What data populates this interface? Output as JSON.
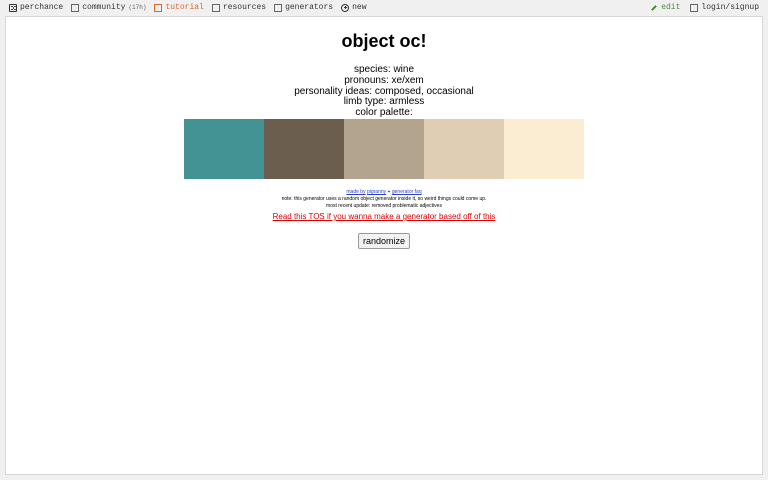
{
  "nav": {
    "left": [
      {
        "label": "perchance",
        "icon": "dice-icon"
      },
      {
        "label": "community",
        "count": "(17h)",
        "icon": "community-icon"
      },
      {
        "label": "tutorial",
        "icon": "book-icon"
      },
      {
        "label": "resources",
        "icon": "box-icon"
      },
      {
        "label": "generators",
        "icon": "grid-icon"
      },
      {
        "label": "new",
        "icon": "plus-circle-icon"
      }
    ],
    "right": [
      {
        "label": "edit",
        "icon": "pencil-icon"
      },
      {
        "label": "login/signup",
        "icon": "user-icon"
      }
    ],
    "accent_tutorial": "#d8682a",
    "accent_edit": "#4a8f3a"
  },
  "page": {
    "title": "object oc!",
    "lines": [
      "species: wine",
      "pronouns: xe/xem",
      "personality ideas: composed, occasional",
      "limb type: armless",
      "color palette:"
    ],
    "palette": [
      "#439395",
      "#6b5e4e",
      "#b2a48f",
      "#dfceb3",
      "#fbedd2"
    ],
    "credits": {
      "made_by_prefix": "made by",
      "made_by_link": "pigranny",
      "separator": "+",
      "faq_link": "generator faq",
      "note": "note: this generator uses a random object generator inside it, so weird things could come up.",
      "update_label": "most recent update:",
      "update_text": "removed problematic adjectives"
    },
    "tos_link": "Read this TOS if you wanna make a generator based off of this",
    "button_label": "randomize"
  }
}
